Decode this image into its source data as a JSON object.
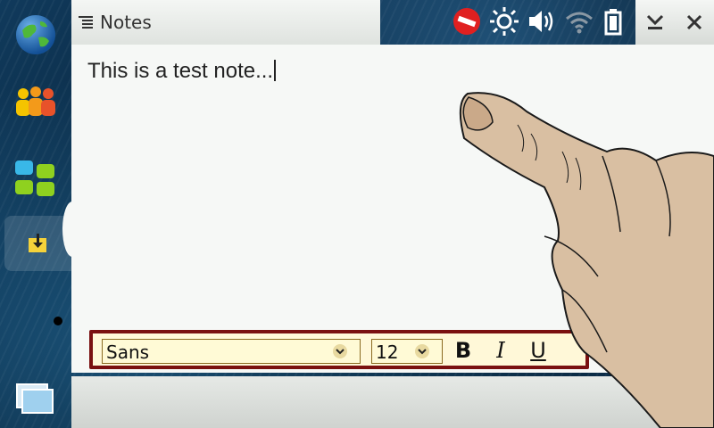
{
  "app": {
    "title": "Notes"
  },
  "note": {
    "content": "This is a test note..."
  },
  "toolbar": {
    "font_value": "Sans",
    "size_value": "12",
    "bold_label": "B",
    "italic_label": "I",
    "underline_label": "U"
  },
  "icons": {
    "launcher": [
      "globe-icon",
      "contacts-icon",
      "applications-icon",
      "notes-app-icon",
      "task-switcher-icon"
    ],
    "status": [
      "presence-busy-icon",
      "brightness-icon",
      "volume-icon",
      "wifi-icon",
      "battery-icon"
    ],
    "window": [
      "minimize-icon",
      "close-icon"
    ]
  },
  "colors": {
    "toolbar_border": "#7a1010",
    "toolbar_bg": "#fff8d8",
    "note_bg": "#f6f8f6"
  }
}
